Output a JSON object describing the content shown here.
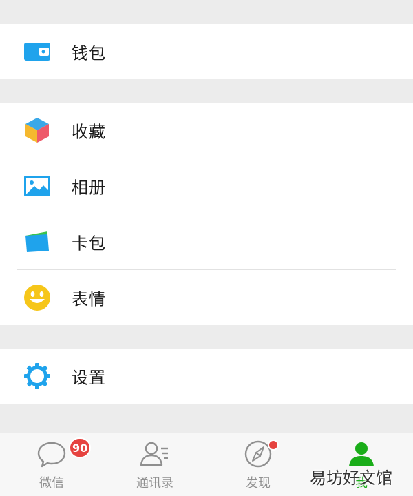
{
  "menu": {
    "wallet": "钱包",
    "favorites": "收藏",
    "album": "相册",
    "card_package": "卡包",
    "stickers": "表情",
    "settings": "设置"
  },
  "tabs": [
    {
      "label": "微信",
      "badge": "90",
      "icon": "chat-bubble-icon"
    },
    {
      "label": "通讯录",
      "icon": "contacts-icon"
    },
    {
      "label": "发现",
      "icon": "compass-icon"
    },
    {
      "label": "我",
      "icon": "person-icon"
    }
  ],
  "watermark": "易坊好文馆",
  "colors": {
    "accent_green": "#1aad19",
    "badge_red": "#e64340",
    "background": "#ececec"
  }
}
